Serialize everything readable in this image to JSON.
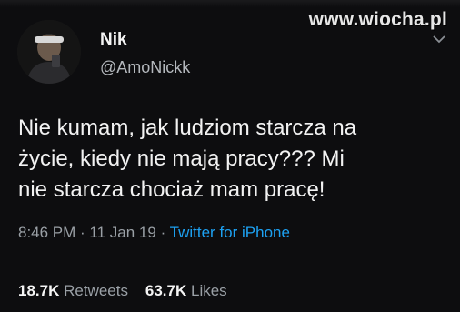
{
  "watermark": "www.wiocha.pl",
  "user": {
    "name": "Nik",
    "handle": "@AmoNickk"
  },
  "tweet": {
    "line1": "Nie kumam, jak ludziom starcza na",
    "line2": "życie, kiedy nie mają pracy??? Mi",
    "line3": "nie starcza chociaż mam pracę!"
  },
  "meta": {
    "time": "8:46 PM",
    "sep1": " · ",
    "date": "11 Jan 19",
    "sep2": " · ",
    "client": "Twitter for iPhone"
  },
  "stats": {
    "retweets_count": "18.7K",
    "retweets_label": "Retweets",
    "likes_count": "63.7K",
    "likes_label": "Likes"
  },
  "colors": {
    "background": "#0d0d0f",
    "accent": "#1da1f2",
    "secondary_text": "#9aa0a6"
  },
  "icons": {
    "menu": "chevron-down-icon"
  }
}
